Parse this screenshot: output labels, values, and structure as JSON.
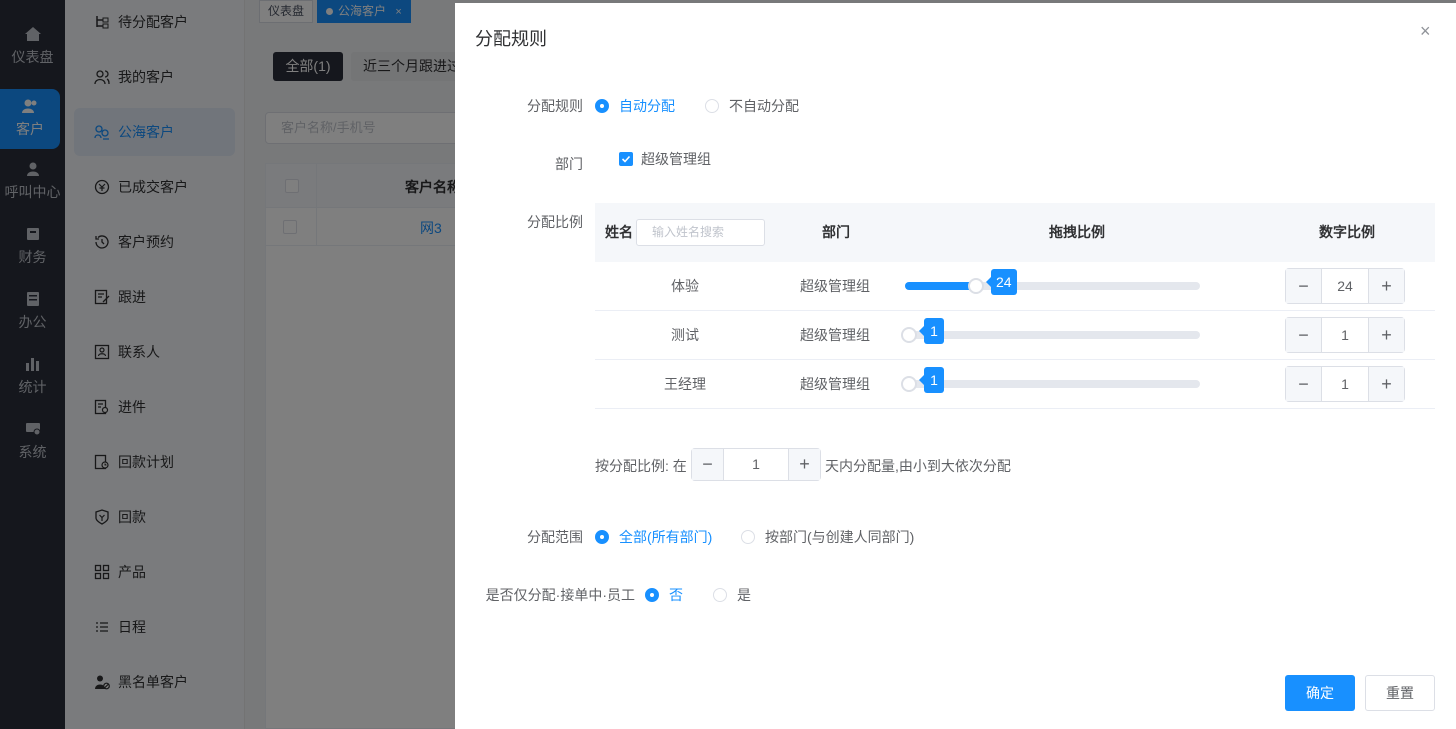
{
  "leftnav": [
    {
      "label": "仪表盘",
      "icon": "home-icon"
    },
    {
      "label": "客户",
      "icon": "users-icon",
      "active": true
    },
    {
      "label": "呼叫中心",
      "icon": "user-icon"
    },
    {
      "label": "财务",
      "icon": "wallet-icon"
    },
    {
      "label": "办公",
      "icon": "office-icon"
    },
    {
      "label": "统计",
      "icon": "bar-chart-icon"
    },
    {
      "label": "系统",
      "icon": "system-icon"
    }
  ],
  "submenu": [
    {
      "label": "待分配客户"
    },
    {
      "label": "我的客户"
    },
    {
      "label": "公海客户",
      "active": true
    },
    {
      "label": "已成交客户"
    },
    {
      "label": "客户预约"
    },
    {
      "label": "跟进"
    },
    {
      "label": "联系人"
    },
    {
      "label": "进件"
    },
    {
      "label": "回款计划"
    },
    {
      "label": "回款"
    },
    {
      "label": "产品"
    },
    {
      "label": "日程"
    },
    {
      "label": "黑名单客户"
    }
  ],
  "page": {
    "tabs": [
      "仪表盘",
      "公海客户"
    ],
    "tab_close": "×",
    "filter_all": "全部(1)",
    "filter_recent": "近三个月跟进过",
    "search_placeholder": "客户名称/手机号",
    "col_customer_name": "客户名称",
    "row_customer": "网3"
  },
  "dialog": {
    "title": "分配规则",
    "close": "×",
    "rule_label": "分配规则",
    "rule_auto": "自动分配",
    "rule_manual": "不自动分配",
    "dept_label": "部门",
    "dept_option": "超级管理组",
    "ratio_label": "分配比例",
    "table": {
      "col_name": "姓名",
      "name_search_placeholder": "输入姓名搜索",
      "col_dept": "部门",
      "col_drag": "拖拽比例",
      "col_number": "数字比例",
      "slider_max": 100,
      "rows": [
        {
          "name": "体验",
          "dept": "超级管理组",
          "value": 24,
          "value_text": "24"
        },
        {
          "name": "测试",
          "dept": "超级管理组",
          "value": 1,
          "value_text": "1"
        },
        {
          "name": "王经理",
          "dept": "超级管理组",
          "value": 1,
          "value_text": "1"
        }
      ]
    },
    "period_prefix": "按分配比例: 在",
    "period_value": "1",
    "period_suffix": "天内分配量,由小到大依次分配",
    "scope_label": "分配范围",
    "scope_all": "全部(所有部门)",
    "scope_dept": "按部门(与创建人同部门)",
    "only_label": "是否仅分配·接单中·员工",
    "only_no": "否",
    "only_yes": "是",
    "confirm": "确定",
    "reset": "重置"
  }
}
